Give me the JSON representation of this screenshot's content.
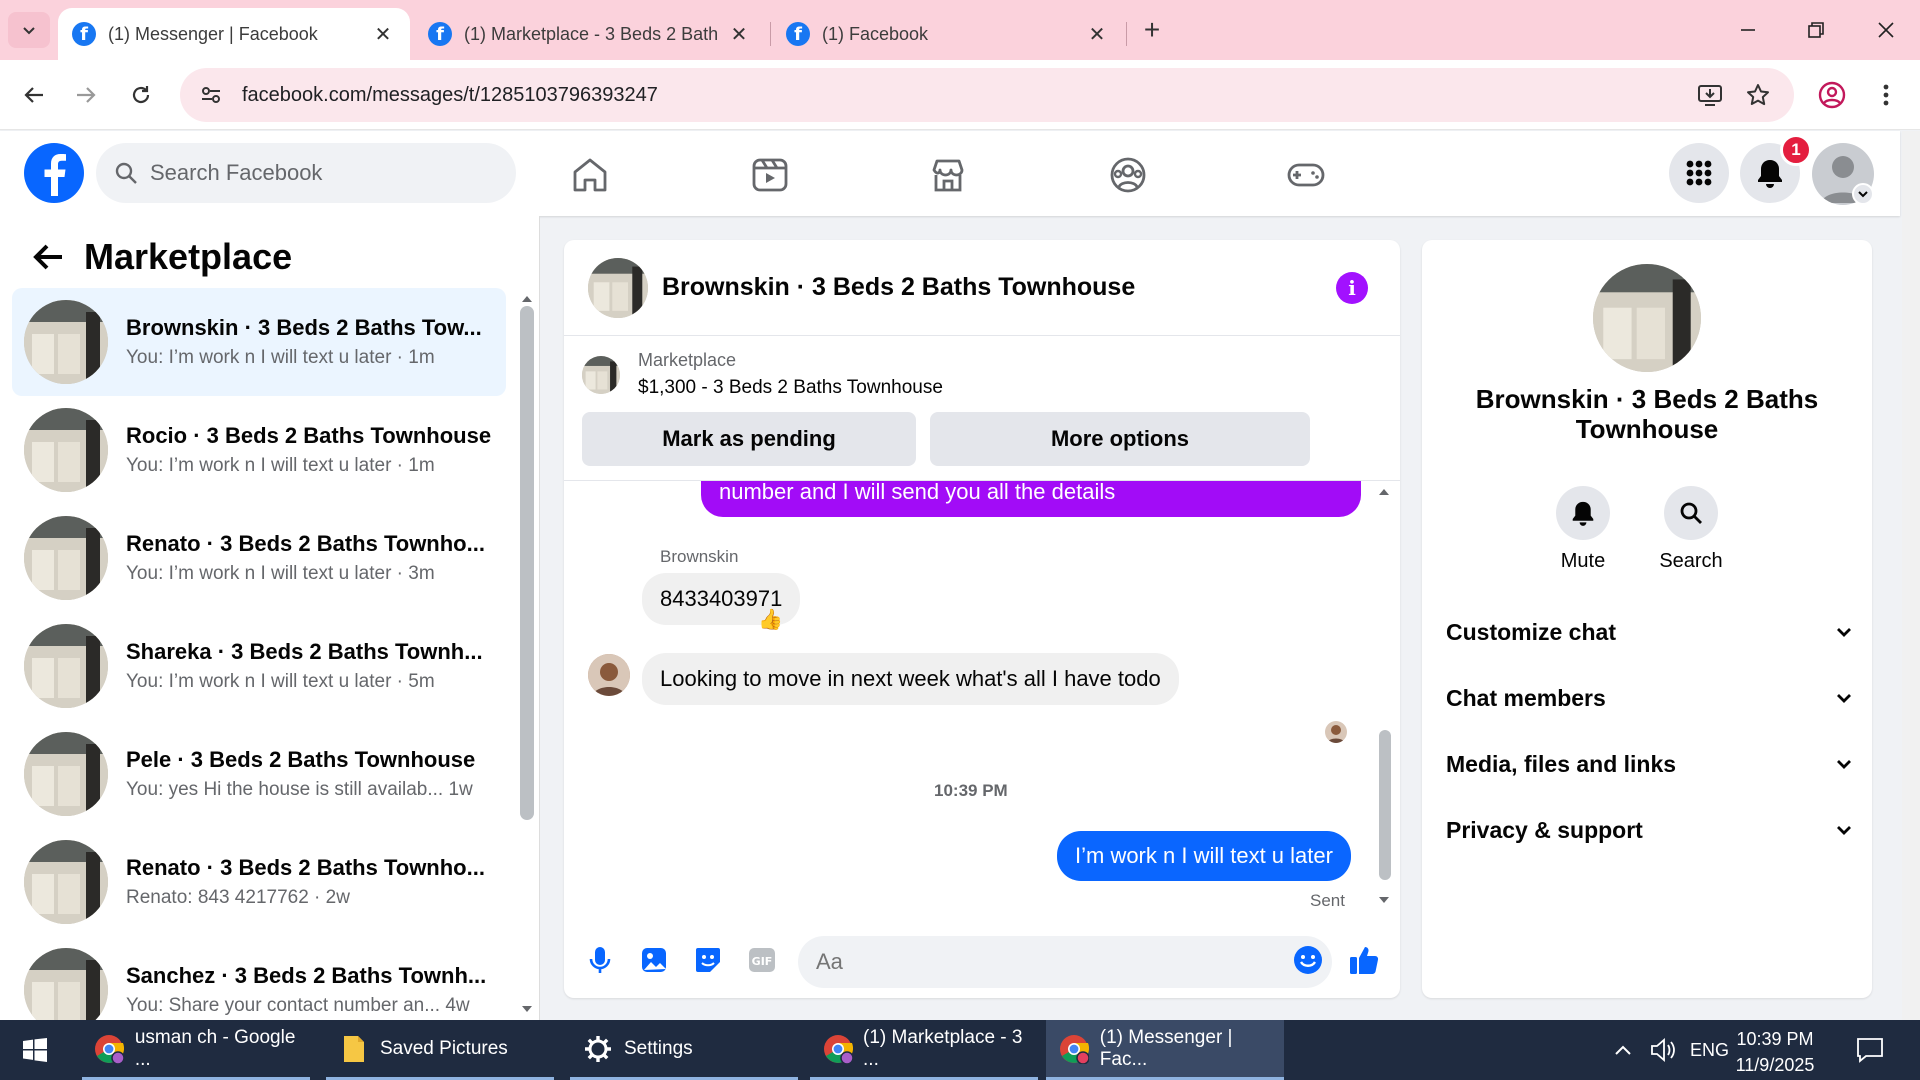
{
  "browser": {
    "tabs": [
      {
        "title": "(1) Messenger | Facebook",
        "active": true
      },
      {
        "title": "(1) Marketplace - 3 Beds 2 Bath",
        "active": false
      },
      {
        "title": "(1) Facebook",
        "active": false
      }
    ],
    "url": "facebook.com/messages/t/1285103796393247"
  },
  "fb": {
    "search_placeholder": "Search Facebook",
    "notification_count": "1",
    "brand_color": "#0866ff"
  },
  "sidebar": {
    "title": "Marketplace",
    "conversations": [
      {
        "name": "Brownskin · 3 Beds 2 Baths Tow...",
        "snippet": "You: I’m work n I will text u later · 1m"
      },
      {
        "name": "Rocio · 3 Beds 2 Baths Townhouse",
        "snippet": "You: I’m work n I will text u later · 1m"
      },
      {
        "name": "Renato · 3 Beds 2 Baths Townho...",
        "snippet": "You: I’m work n I will text u later · 3m"
      },
      {
        "name": "Shareka · 3 Beds 2 Baths Townh...",
        "snippet": "You: I’m work n I will text u later · 5m"
      },
      {
        "name": "Pele · 3 Beds 2 Baths Townhouse",
        "snippet": "You: yes Hi the house is still availab...   1w"
      },
      {
        "name": "Renato · 3 Beds 2 Baths Townho...",
        "snippet": "Renato: 843 4217762 · 2w"
      },
      {
        "name": "Sanchez · 3 Beds 2 Baths Townh...",
        "snippet": "You: Share your contact number an...   4w"
      }
    ]
  },
  "chat": {
    "title": "Brownskin · 3 Beds 2 Baths Townhouse",
    "listing_label": "Marketplace",
    "listing_price": "$1,300 - 3 Beds 2 Baths Townhouse",
    "mark_pending": "Mark as pending",
    "more_options": "More options",
    "messages": {
      "partial_sent": "number and I will send you all the details",
      "sender_label": "Brownskin",
      "phone": "8433403971",
      "reaction": "👍",
      "incoming": "Looking to move in next week what's all I have todo",
      "timestamp": "10:39 PM",
      "outgoing": "I’m work n I will text u later",
      "status": "Sent"
    },
    "input_placeholder": "Aa",
    "colors": {
      "sent": "#0a66ff",
      "purple": "#a20cf7"
    }
  },
  "details": {
    "name": "Brownskin · 3 Beds 2 Baths Townhouse",
    "mute": "Mute",
    "search": "Search",
    "sections": [
      "Customize chat",
      "Chat members",
      "Media, files and links",
      "Privacy & support"
    ]
  },
  "taskbar": {
    "items": [
      "usman ch - Google ...",
      "Saved Pictures",
      "Settings",
      "(1) Marketplace - 3 ...",
      "(1) Messenger | Fac..."
    ],
    "language": "ENG",
    "time": "10:39 PM",
    "date": "11/9/2025"
  }
}
